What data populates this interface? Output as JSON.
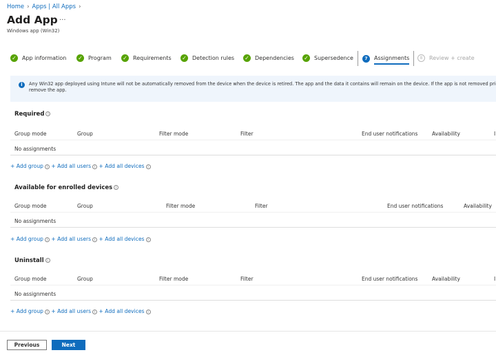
{
  "breadcrumb": [
    "Home",
    "Apps | All Apps"
  ],
  "header": {
    "title": "Add App",
    "more": "···",
    "subtitle": "Windows app (Win32)"
  },
  "steps": [
    {
      "label": "App information",
      "status": "complete"
    },
    {
      "label": "Program",
      "status": "complete"
    },
    {
      "label": "Requirements",
      "status": "complete"
    },
    {
      "label": "Detection rules",
      "status": "complete"
    },
    {
      "label": "Dependencies",
      "status": "complete"
    },
    {
      "label": "Supersedence",
      "status": "complete"
    },
    {
      "label": "Assignments",
      "status": "active",
      "number": "7"
    },
    {
      "label": "Review + create",
      "status": "disabled",
      "number": "8"
    }
  ],
  "banner": {
    "text": "Any Win32 app deployed using Intune will not be automatically removed from the device when the device is retired. The app and the data it contains will remain on the device. If the app is not removed prior to",
    "text2": "remove the app."
  },
  "sections": [
    {
      "title": "Required",
      "columns": [
        "Group mode",
        "Group",
        "Filter mode",
        "Filter",
        "End user notifications",
        "Availability",
        "I"
      ],
      "empty": "No assignments"
    },
    {
      "title": "Available for enrolled devices",
      "columns": [
        "Group mode",
        "Group",
        "Filter mode",
        "Filter",
        "End user notifications",
        "Availability"
      ],
      "empty": "No assignments"
    },
    {
      "title": "Uninstall",
      "columns": [
        "Group mode",
        "Group",
        "Filter mode",
        "Filter",
        "End user notifications",
        "Availability",
        "I"
      ],
      "empty": "No assignments"
    }
  ],
  "links": {
    "add_group": "+ Add group",
    "add_all_users": "+ Add all users",
    "add_all_devices": "+ Add all devices"
  },
  "footer": {
    "previous": "Previous",
    "next": "Next"
  },
  "colors": {
    "accent": "#0f6cbd",
    "success": "#57a300",
    "banner_bg": "#eff5fc"
  }
}
